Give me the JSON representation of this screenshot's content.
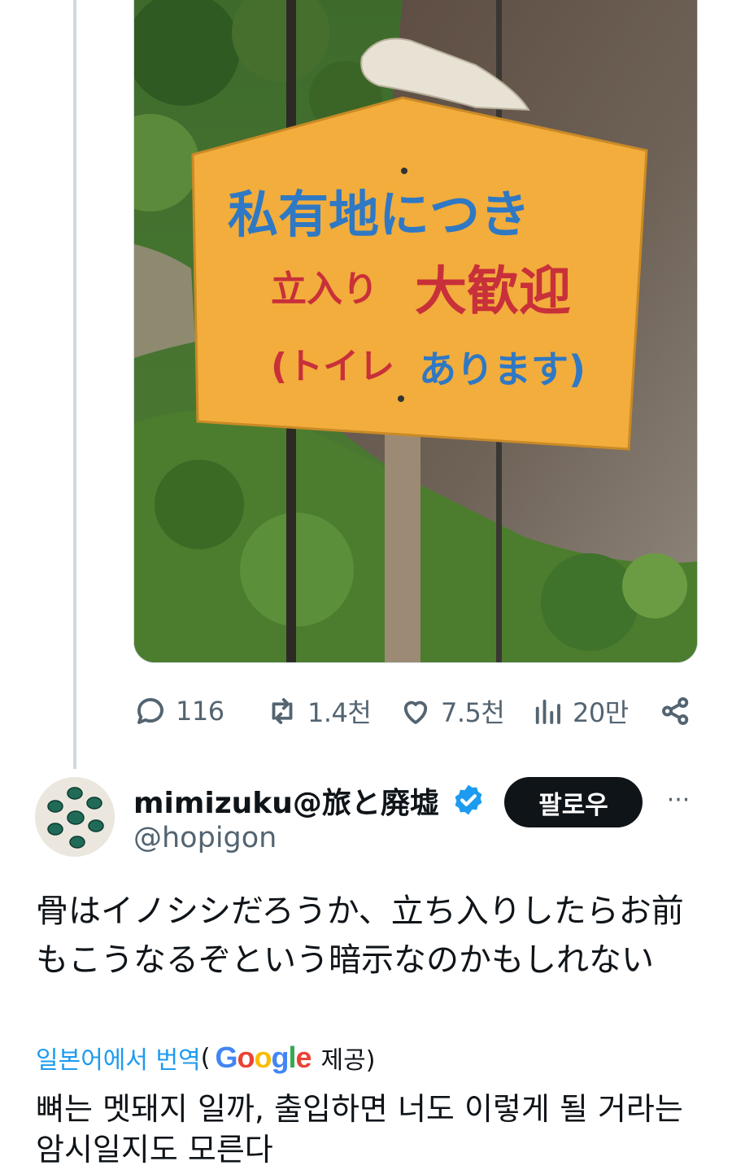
{
  "sign": {
    "line1": "私有地につき",
    "line2a": "立入り",
    "line2b": "大歓迎",
    "line3a": "(トイレ",
    "line3b": "あります)"
  },
  "actions": {
    "replies": "116",
    "reposts": "1.4천",
    "likes": "7.5천",
    "views": "20만"
  },
  "icons": [
    "reply-icon",
    "repost-icon",
    "like-icon",
    "views-icon",
    "share-icon",
    "verified-icon",
    "more-icon"
  ],
  "reply": {
    "display_name": "mimizuku@旅と廃墟",
    "handle": "@hopigon",
    "follow_label": "팔로우",
    "more_label": "···",
    "text": "骨はイノシシだろうか、立ち入りしたらお前もこうなるぞという暗示なのかもしれない",
    "translate_label": "일본어에서 번역",
    "translate_open": "(",
    "translate_provider": "Google",
    "translate_suffix": "제공)",
    "translated_text": "뼈는 멧돼지 일까, 출입하면 너도 이렇게 될 거라는 암시일지도 모른다"
  },
  "colors": {
    "accent": "#1d9bf0",
    "text": "#0f1419",
    "muted": "#536471",
    "sign": "#f2ad3c",
    "sign_blue": "#2f78c4",
    "sign_red": "#c8303a"
  }
}
